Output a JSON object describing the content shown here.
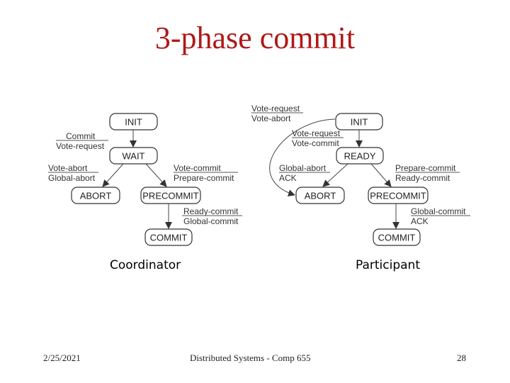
{
  "title": "3-phase commit",
  "captions": {
    "coordinator": "Coordinator",
    "participant": "Participant"
  },
  "footer": {
    "date": "2/25/2021",
    "course": "Distributed Systems - Comp 655",
    "page": "28"
  },
  "colors": {
    "title": "#b01818"
  },
  "coordinator": {
    "nodes": {
      "init": "INIT",
      "wait": "WAIT",
      "abort": "ABORT",
      "precommit": "PRECOMMIT",
      "commit": "COMMIT"
    },
    "transitions": [
      {
        "from": "INIT",
        "to": "WAIT",
        "event": "Commit",
        "action": "Vote-request"
      },
      {
        "from": "WAIT",
        "to": "ABORT",
        "event": "Vote-abort",
        "action": "Global-abort"
      },
      {
        "from": "WAIT",
        "to": "PRECOMMIT",
        "event": "Vote-commit",
        "action": "Prepare-commit"
      },
      {
        "from": "PRECOMMIT",
        "to": "COMMIT",
        "event": "Ready-commit",
        "action": "Global-commit"
      }
    ]
  },
  "participant": {
    "nodes": {
      "init": "INIT",
      "ready": "READY",
      "abort": "ABORT",
      "precommit": "PRECOMMIT",
      "commit": "COMMIT"
    },
    "transitions": [
      {
        "from": "INIT",
        "to": "ABORT",
        "event": "Vote-request",
        "action": "Vote-abort"
      },
      {
        "from": "INIT",
        "to": "READY",
        "event": "Vote-request",
        "action": "Vote-commit"
      },
      {
        "from": "READY",
        "to": "ABORT",
        "event": "Global-abort",
        "action": "ACK"
      },
      {
        "from": "READY",
        "to": "PRECOMMIT",
        "event": "Prepare-commit",
        "action": "Ready-commit"
      },
      {
        "from": "PRECOMMIT",
        "to": "COMMIT",
        "event": "Global-commit",
        "action": "ACK"
      }
    ]
  }
}
